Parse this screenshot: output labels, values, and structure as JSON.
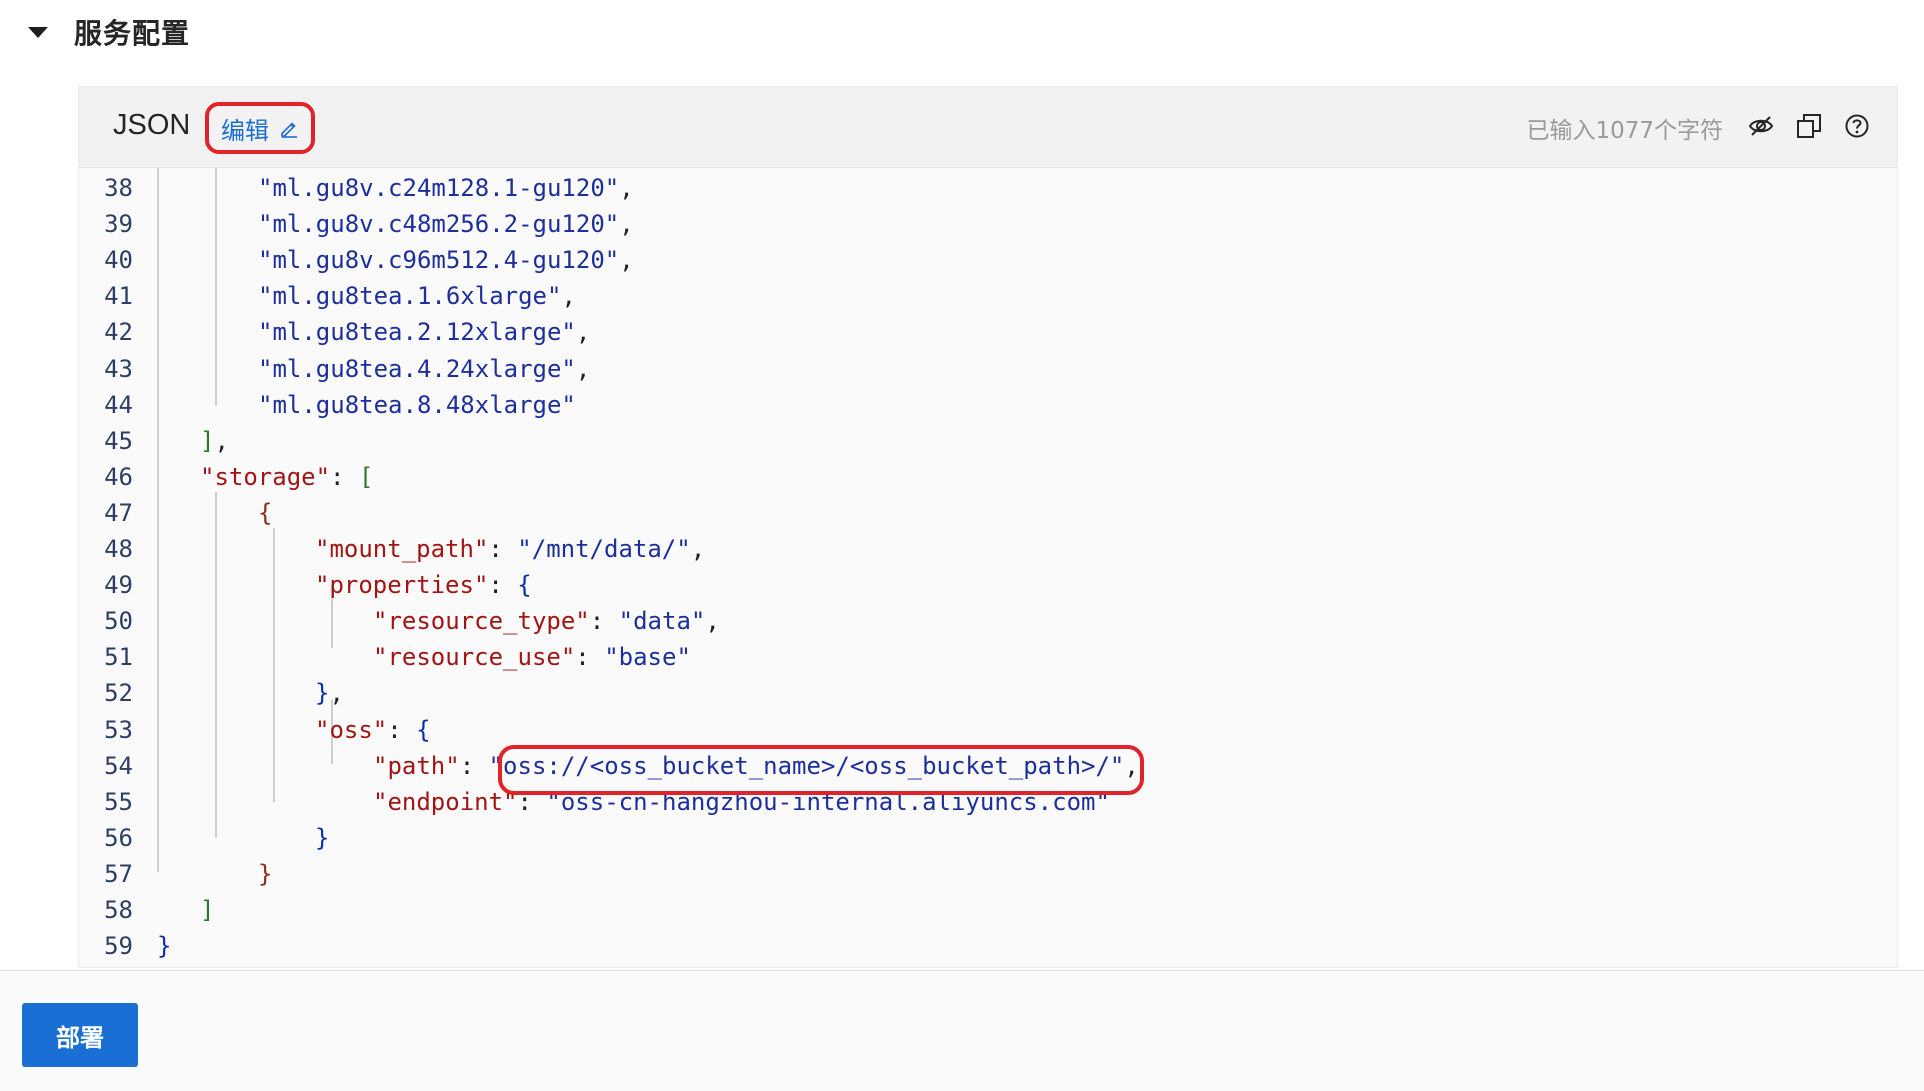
{
  "section": {
    "title": "服务配置"
  },
  "editor": {
    "format_label": "JSON",
    "edit_label": "编辑",
    "char_count": "已输入1077个字符",
    "icons": [
      "eye-slash-icon",
      "copy-icon",
      "help-icon"
    ]
  },
  "code_lines": [
    {
      "n": "38",
      "tokens": [
        [
          "s",
          "\"ml.gu8v.c24m128.1-gu120\""
        ],
        [
          "p",
          ","
        ]
      ]
    },
    {
      "n": "39",
      "tokens": [
        [
          "s",
          "\"ml.gu8v.c48m256.2-gu120\""
        ],
        [
          "p",
          ","
        ]
      ]
    },
    {
      "n": "40",
      "tokens": [
        [
          "s",
          "\"ml.gu8v.c96m512.4-gu120\""
        ],
        [
          "p",
          ","
        ]
      ]
    },
    {
      "n": "41",
      "tokens": [
        [
          "s",
          "\"ml.gu8tea.1.6xlarge\""
        ],
        [
          "p",
          ","
        ]
      ]
    },
    {
      "n": "42",
      "tokens": [
        [
          "s",
          "\"ml.gu8tea.2.12xlarge\""
        ],
        [
          "p",
          ","
        ]
      ]
    },
    {
      "n": "43",
      "tokens": [
        [
          "s",
          "\"ml.gu8tea.4.24xlarge\""
        ],
        [
          "p",
          ","
        ]
      ]
    },
    {
      "n": "44",
      "tokens": [
        [
          "s",
          "\"ml.gu8tea.8.48xlarge\""
        ]
      ]
    },
    {
      "n": "45",
      "tokens": [
        [
          "b2",
          "]"
        ],
        [
          "p",
          ","
        ]
      ]
    },
    {
      "n": "46",
      "tokens": [
        [
          "k",
          "\"storage\""
        ],
        [
          "p",
          ": "
        ],
        [
          "b2",
          "["
        ]
      ]
    },
    {
      "n": "47",
      "tokens": [
        [
          "b3",
          "{"
        ]
      ]
    },
    {
      "n": "48",
      "tokens": [
        [
          "k",
          "\"mount_path\""
        ],
        [
          "p",
          ": "
        ],
        [
          "s",
          "\"/mnt/data/\""
        ],
        [
          "p",
          ","
        ]
      ]
    },
    {
      "n": "49",
      "tokens": [
        [
          "k",
          "\"properties\""
        ],
        [
          "p",
          ": "
        ],
        [
          "b1",
          "{"
        ]
      ]
    },
    {
      "n": "50",
      "tokens": [
        [
          "k",
          "\"resource_type\""
        ],
        [
          "p",
          ": "
        ],
        [
          "s",
          "\"data\""
        ],
        [
          "p",
          ","
        ]
      ]
    },
    {
      "n": "51",
      "tokens": [
        [
          "k",
          "\"resource_use\""
        ],
        [
          "p",
          ": "
        ],
        [
          "s",
          "\"base\""
        ]
      ]
    },
    {
      "n": "52",
      "tokens": [
        [
          "b1",
          "}"
        ],
        [
          "p",
          ","
        ]
      ]
    },
    {
      "n": "53",
      "tokens": [
        [
          "k",
          "\"oss\""
        ],
        [
          "p",
          ": "
        ],
        [
          "b1",
          "{"
        ]
      ]
    },
    {
      "n": "54",
      "tokens": [
        [
          "k",
          "\"path\""
        ],
        [
          "p",
          ": "
        ],
        [
          "s",
          "\"oss://<oss_bucket_name>/<oss_bucket_path>/\""
        ],
        [
          "p",
          ","
        ]
      ]
    },
    {
      "n": "55",
      "tokens": [
        [
          "k",
          "\"endpoint\""
        ],
        [
          "p",
          ": "
        ],
        [
          "s",
          "\"oss-cn-hangzhou-internal.aliyuncs.com\""
        ]
      ]
    },
    {
      "n": "56",
      "tokens": [
        [
          "b1",
          "}"
        ]
      ]
    },
    {
      "n": "57",
      "tokens": [
        [
          "b3",
          "}"
        ]
      ]
    },
    {
      "n": "58",
      "tokens": [
        [
          "b2",
          "]"
        ]
      ]
    },
    {
      "n": "59",
      "tokens": [
        [
          "b1",
          "}"
        ]
      ]
    }
  ],
  "footer": {
    "deploy_label": "部署"
  }
}
